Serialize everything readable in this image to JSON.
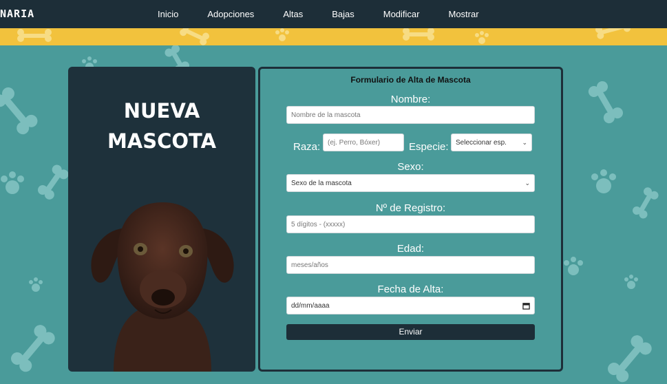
{
  "navbar": {
    "brand": "NARIA",
    "links": [
      "Inicio",
      "Adopciones",
      "Altas",
      "Bajas",
      "Modificar",
      "Mostrar"
    ]
  },
  "panel": {
    "title_line1": "NUEVA",
    "title_line2": "MASCOTA"
  },
  "form": {
    "heading": "Formulario de Alta de Mascota",
    "nombre_label": "Nombre:",
    "nombre_placeholder": "Nombre de la mascota",
    "raza_label": "Raza:",
    "raza_placeholder": "(ej. Perro, Bóxer)",
    "especie_label": "Especie:",
    "especie_selected": "Seleccionar esp.",
    "sexo_label": "Sexo:",
    "sexo_selected": "Sexo de la mascota",
    "registro_label": "Nº de Registro:",
    "registro_placeholder": "5 dígitos - (xxxxx)",
    "edad_label": "Edad:",
    "edad_placeholder": "meses/años",
    "fecha_label": "Fecha de Alta:",
    "fecha_placeholder": "dd/mm/aaaa",
    "submit_label": "Enviar"
  },
  "colors": {
    "navbar": "#1d2e38",
    "background": "#4a9b9a",
    "strip": "#f2c23d",
    "panel": "#1e313b",
    "decoration": "#8fd0cf"
  },
  "icons": [
    "bone-icon",
    "paw-icon",
    "calendar-icon",
    "chevron-down-icon"
  ]
}
